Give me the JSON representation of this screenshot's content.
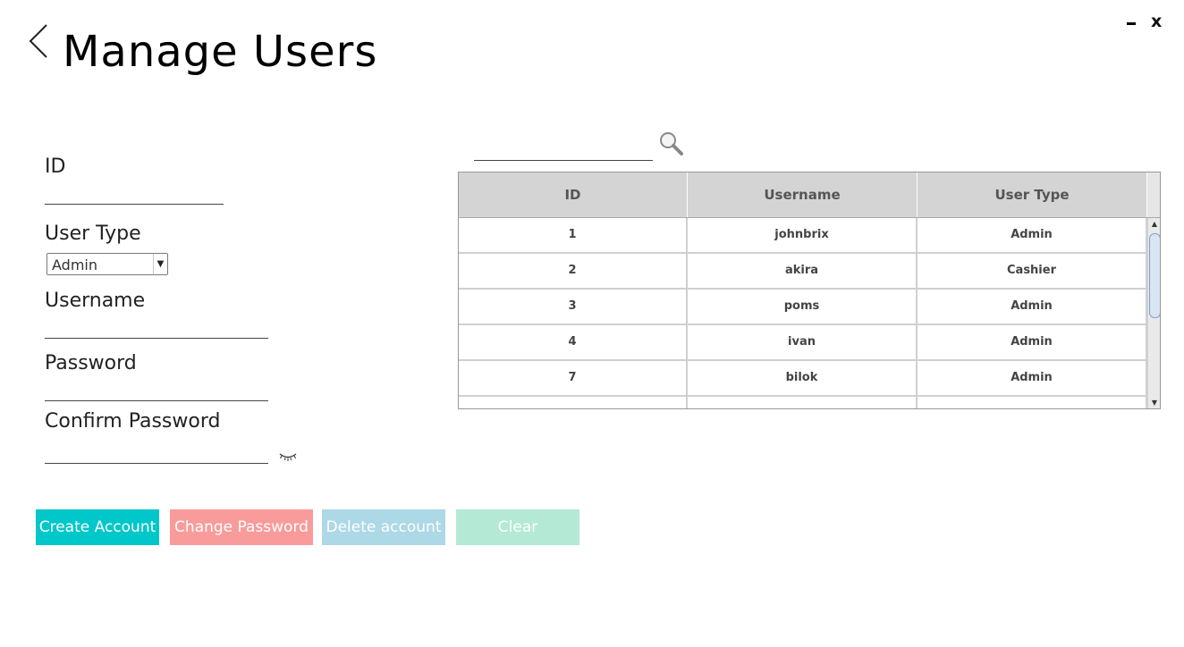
{
  "header": {
    "title": "Manage Users",
    "back_icon": "chevron-left-icon",
    "minimize_label": "-",
    "close_label": "x"
  },
  "form": {
    "id_label": "ID",
    "id_value": "",
    "user_type_label": "User Type",
    "user_type_value": "Admin",
    "username_label": "Username",
    "username_value": "",
    "password_label": "Password",
    "password_value": "",
    "confirm_password_label": "Confirm Password",
    "confirm_password_value": "",
    "eye_icon": "eye-closed-icon"
  },
  "buttons": {
    "create": "Create Account",
    "change": "Change Password",
    "delete": "Delete account",
    "clear": "Clear"
  },
  "search": {
    "value": "",
    "icon": "search-icon"
  },
  "table": {
    "columns": [
      "ID",
      "Username",
      "User Type"
    ],
    "rows": [
      {
        "id": "1",
        "username": "johnbrix",
        "type": "Admin"
      },
      {
        "id": "2",
        "username": "akira",
        "type": "Cashier"
      },
      {
        "id": "3",
        "username": "poms",
        "type": "Admin"
      },
      {
        "id": "4",
        "username": "ivan",
        "type": "Admin"
      },
      {
        "id": "7",
        "username": "bilok",
        "type": "Admin"
      },
      {
        "id": "",
        "username": "",
        "type": ""
      }
    ]
  },
  "colors": {
    "create": "#00c7c9",
    "change": "#f99b9b",
    "delete": "#add8e6",
    "clear": "#b3e9d5",
    "table_header": "#d4d4d4"
  }
}
